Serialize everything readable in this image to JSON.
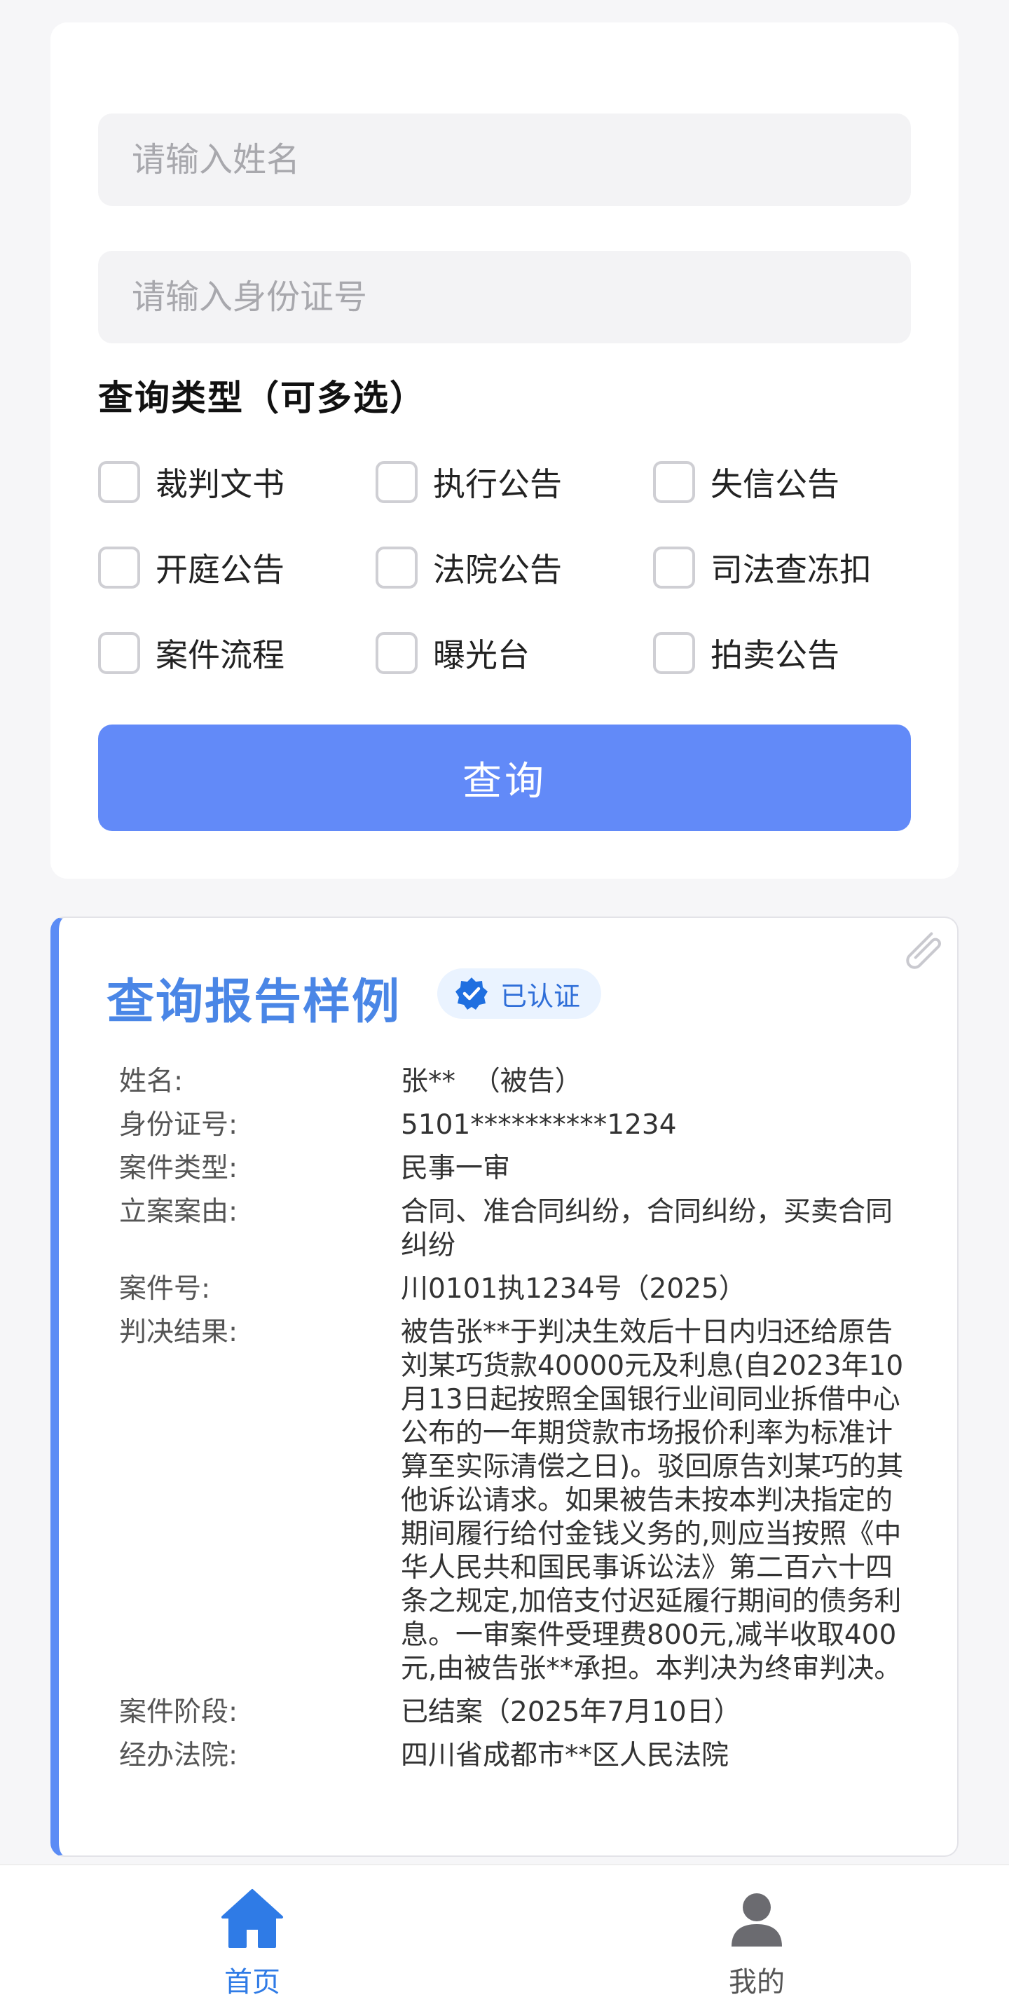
{
  "form": {
    "name_placeholder": "请输入姓名",
    "id_placeholder": "请输入身份证号",
    "type_title": "查询类型（可多选）",
    "options": [
      "裁判文书",
      "执行公告",
      "失信公告",
      "开庭公告",
      "法院公告",
      "司法查冻扣",
      "案件流程",
      "曝光台",
      "拍卖公告"
    ],
    "submit_label": "查询",
    "accent_color": "#628af8"
  },
  "report": {
    "title": "查询报告样例",
    "badge": "已认证",
    "rows": [
      {
        "label": "姓名:",
        "value": "张**  （被告）"
      },
      {
        "label": "身份证号:",
        "value": "5101**********1234"
      },
      {
        "label": "案件类型:",
        "value": "民事一审"
      },
      {
        "label": "立案案由:",
        "value": "合同、准合同纠纷，合同纠纷，买卖合同纠纷"
      },
      {
        "label": "案件号:",
        "value": "川0101执1234号（2025）"
      },
      {
        "label": "判决结果:",
        "value": "被告张**于判决生效后十日内归还给原告刘某巧货款40000元及利息(自2023年10月13日起按照全国银行业间同业拆借中心公布的一年期贷款市场报价利率为标准计算至实际清偿之日)。驳回原告刘某巧的其他诉讼请求。如果被告未按本判决指定的期间履行给付金钱义务的,则应当按照《中华人民共和国民事诉讼法》第二百六十四条之规定,加倍支付迟延履行期间的债务利息。一审案件受理费800元,减半收取400元,由被告张**承担。本判决为终审判决。"
      },
      {
        "label": "案件阶段:",
        "value": "已结案（2025年7月10日）"
      },
      {
        "label": "经办法院:",
        "value": "四川省成都市**区人民法院"
      }
    ]
  },
  "nav": {
    "home_label": "首页",
    "mine_label": "我的",
    "active_color": "#2f7be6"
  }
}
